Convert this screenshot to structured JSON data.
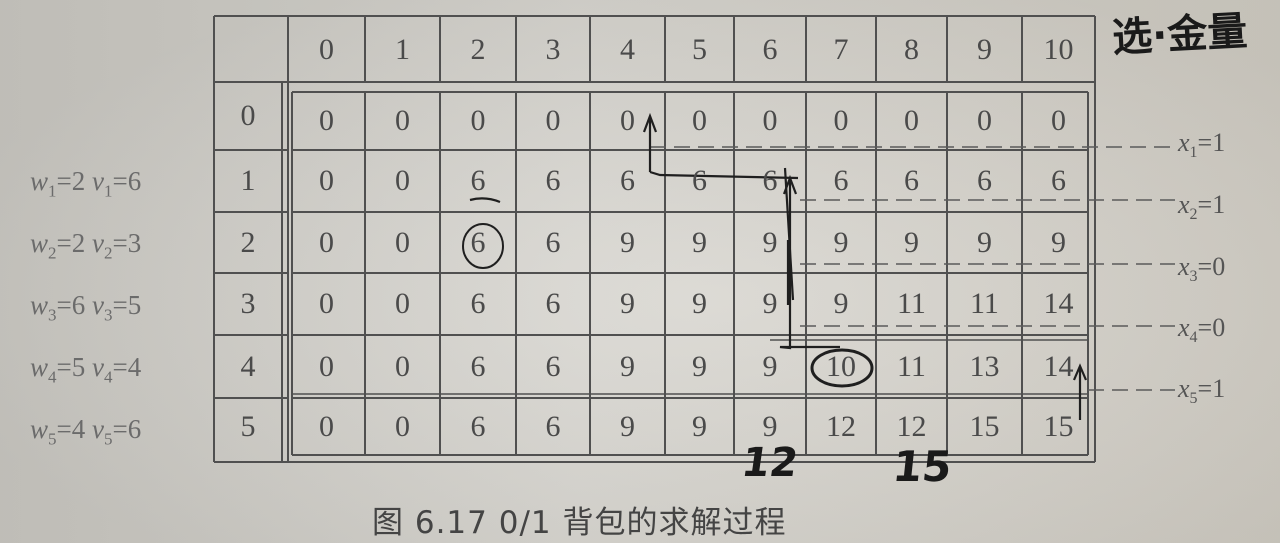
{
  "table": {
    "col_headers": [
      "0",
      "1",
      "2",
      "3",
      "4",
      "5",
      "6",
      "7",
      "8",
      "9",
      "10"
    ],
    "row_headers": [
      "0",
      "1",
      "2",
      "3",
      "4",
      "5"
    ],
    "rows": [
      [
        "0",
        "0",
        "0",
        "0",
        "0",
        "0",
        "0",
        "0",
        "0",
        "0",
        "0"
      ],
      [
        "0",
        "0",
        "6",
        "6",
        "6",
        "6",
        "6",
        "6",
        "6",
        "6",
        "6"
      ],
      [
        "0",
        "0",
        "6",
        "6",
        "9",
        "9",
        "9",
        "9",
        "9",
        "9",
        "9"
      ],
      [
        "0",
        "0",
        "6",
        "6",
        "9",
        "9",
        "9",
        "9",
        "11",
        "11",
        "14"
      ],
      [
        "0",
        "0",
        "6",
        "6",
        "9",
        "9",
        "9",
        "10",
        "11",
        "13",
        "14"
      ],
      [
        "0",
        "0",
        "6",
        "6",
        "9",
        "9",
        "9",
        "12",
        "12",
        "15",
        "15"
      ]
    ]
  },
  "items": [
    {
      "w_sub": "1",
      "w": "2",
      "v_sub": "1",
      "v": "6"
    },
    {
      "w_sub": "2",
      "w": "2",
      "v_sub": "2",
      "v": "3"
    },
    {
      "w_sub": "3",
      "w": "6",
      "v_sub": "3",
      "v": "5"
    },
    {
      "w_sub": "4",
      "w": "5",
      "v_sub": "4",
      "v": "4"
    },
    {
      "w_sub": "5",
      "w": "4",
      "v_sub": "5",
      "v": "6"
    }
  ],
  "x_labels": [
    {
      "sub": "1",
      "val": "1"
    },
    {
      "sub": "2",
      "val": "1"
    },
    {
      "sub": "3",
      "val": "0"
    },
    {
      "sub": "4",
      "val": "0"
    },
    {
      "sub": "5",
      "val": "1"
    }
  ],
  "caption": "图 6.17   0/1 背包的求解过程",
  "handwriting": {
    "top_right": "选·金量",
    "under_col7": "12",
    "under_col9": "15"
  },
  "colors": {
    "ink": "#4a4a4a",
    "pen": "#1a1a1a",
    "rule": "#4d4d4d"
  }
}
